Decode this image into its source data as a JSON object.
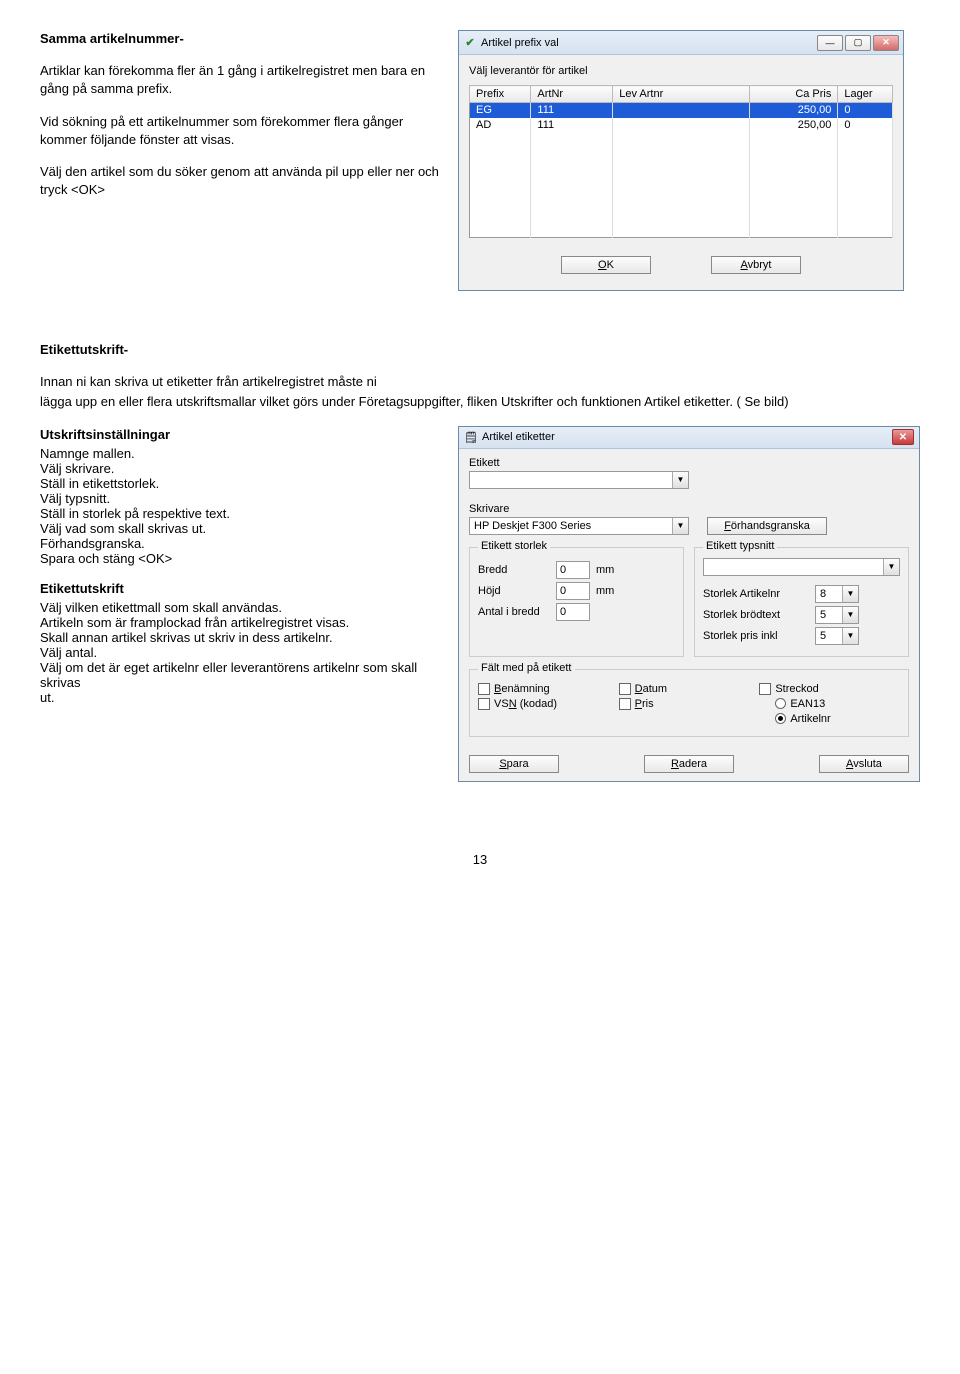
{
  "section1": {
    "heading": "Samma artikelnummer-",
    "p1": "Artiklar kan förekomma fler än 1 gång i artikelregistret men bara en gång på samma prefix.",
    "p2": "Vid sökning på ett artikelnummer som förekommer flera gånger kommer följande fönster att visas.",
    "p3": "Välj den artikel som du söker genom att använda pil upp eller ner och tryck <OK>"
  },
  "dlg1": {
    "title": "Artikel prefix val",
    "subtitle": "Välj leverantör för artikel",
    "headers": [
      "Prefix",
      "ArtNr",
      "Lev Artnr",
      "Ca Pris",
      "Lager"
    ],
    "rows": [
      {
        "prefix": "EG",
        "artnr": "111",
        "lev": "",
        "pris": "250,00",
        "lager": "0",
        "sel": true
      },
      {
        "prefix": "AD",
        "artnr": "111",
        "lev": "",
        "pris": "250,00",
        "lager": "0",
        "sel": false
      }
    ],
    "ok": "OK",
    "cancel": "Avbryt"
  },
  "section2": {
    "heading": "Etikettutskrift-",
    "p1a": "Innan ni kan skriva ut etiketter från artikelregistret måste ni",
    "p1b": "lägga upp en eller flera utskriftsmallar vilket görs under Företagsuppgifter, fliken Utskrifter och funktionen Artikel etiketter. ( Se bild)",
    "sub1": "Utskriftsinställningar",
    "l1": "Namnge mallen.",
    "l2": "Välj skrivare.",
    "l3": "Ställ in etikettstorlek.",
    "l4": "Välj typsnitt.",
    "l5": "Ställ in storlek på respektive text.",
    "l6": "Välj vad som skall skrivas ut.",
    "l7": "Förhandsgranska.",
    "l8": "Spara och stäng <OK>",
    "sub2": "Etikettutskrift",
    "m1": "Välj vilken etikettmall som skall användas.",
    "m2": "Artikeln som är framplockad från artikelregistret visas.",
    "m3": "Skall annan artikel skrivas ut skriv in dess artikelnr.",
    "m4": "Välj antal.",
    "m5": "Välj om det är eget artikelnr eller leverantörens artikelnr som skall skrivas",
    "m6": "ut."
  },
  "dlg2": {
    "title": "Artikel etiketter",
    "lblEtikett": "Etikett",
    "lblSkrivare": "Skrivare",
    "skrivareVal": "HP Deskjet F300 Series",
    "btnPreview": "Förhandsgranska",
    "grpStorlek": "Etikett storlek",
    "bredd": "Bredd",
    "breddVal": "0",
    "hojd": "Höjd",
    "hojdVal": "0",
    "antal": "Antal i bredd",
    "antalVal": "0",
    "mm": "mm",
    "grpTypsnitt": "Etikett typsnitt",
    "sArt": "Storlek Artikelnr",
    "sArtV": "8",
    "sBrod": "Storlek brödtext",
    "sBrodV": "5",
    "sPris": "Storlek pris inkl",
    "sPrisV": "5",
    "grpFalt": "Fält med på etikett",
    "cBen": "Benämning",
    "cVsn": "VSN (kodad)",
    "cDat": "Datum",
    "cPris": "Pris",
    "cStr": "Streckod",
    "rEan": "EAN13",
    "rArt": "Artikelnr",
    "btnSave": "Spara",
    "btnDel": "Radera",
    "btnExit": "Avsluta"
  },
  "pagenum": "13"
}
